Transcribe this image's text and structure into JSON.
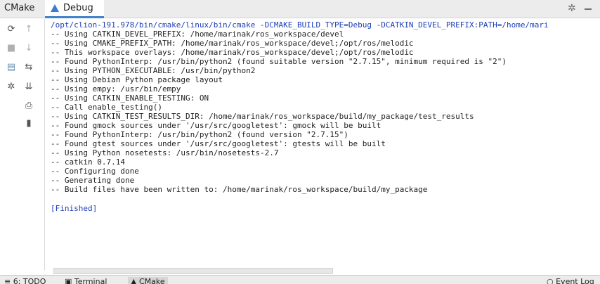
{
  "header": {
    "tool_title": "CMake",
    "tab_label": "Debug"
  },
  "console": {
    "lines": [
      "/opt/clion-191.978/bin/cmake/linux/bin/cmake -DCMAKE_BUILD_TYPE=Debug -DCATKIN_DEVEL_PREFIX:PATH=/home/mari",
      "-- Using CATKIN_DEVEL_PREFIX: /home/marinak/ros_workspace/devel",
      "-- Using CMAKE_PREFIX_PATH: /home/marinak/ros_workspace/devel;/opt/ros/melodic",
      "-- This workspace overlays: /home/marinak/ros_workspace/devel;/opt/ros/melodic",
      "-- Found PythonInterp: /usr/bin/python2 (found suitable version \"2.7.15\", minimum required is \"2\")",
      "-- Using PYTHON_EXECUTABLE: /usr/bin/python2",
      "-- Using Debian Python package layout",
      "-- Using empy: /usr/bin/empy",
      "-- Using CATKIN_ENABLE_TESTING: ON",
      "-- Call enable_testing()",
      "-- Using CATKIN_TEST_RESULTS_DIR: /home/marinak/ros_workspace/build/my_package/test_results",
      "-- Found gmock sources under '/usr/src/googletest': gmock will be built",
      "-- Found PythonInterp: /usr/bin/python2 (found version \"2.7.15\")",
      "-- Found gtest sources under '/usr/src/googletest': gtests will be built",
      "-- Using Python nosetests: /usr/bin/nosetests-2.7",
      "-- catkin 0.7.14",
      "-- Configuring done",
      "-- Generating done",
      "-- Build files have been written to: /home/marinak/ros_workspace/build/my_package"
    ],
    "finished": "[Finished]"
  },
  "bottom_bar": {
    "todo": "6: TODO",
    "terminal": "Terminal",
    "cmake": "CMake",
    "event_log": "Event Log"
  },
  "icons": {
    "rerun": "reload-icon",
    "up": "arrow-up-icon",
    "stop": "stop-icon",
    "down": "arrow-down-icon",
    "cache": "cmake-cache-icon",
    "wrap": "soft-wrap-icon",
    "settings": "gear-icon",
    "scroll_end": "scroll-to-end-icon",
    "print": "print-icon",
    "clear": "trash-icon"
  },
  "colors": {
    "accent": "#4083c9",
    "command_text": "#2040b5"
  }
}
